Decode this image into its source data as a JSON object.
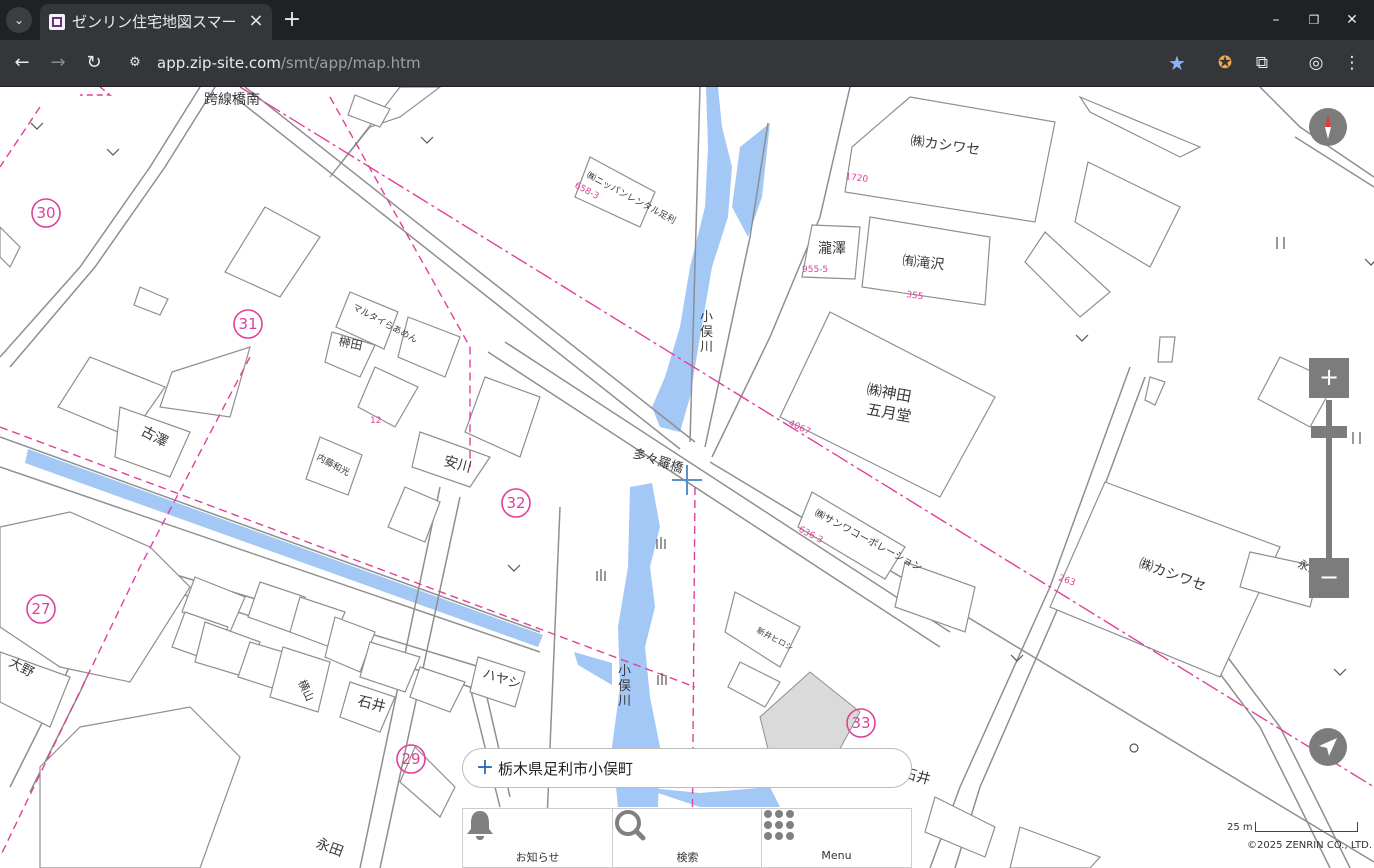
{
  "browser": {
    "tab_title": "ゼンリン住宅地図スマー",
    "tab_close": "×",
    "new_tab": "+",
    "url_host": "app.zip-site.com",
    "url_path": "/smt/app/map.htm",
    "tab_menu_glyph": "⌄",
    "back_glyph": "←",
    "forward_glyph": "→",
    "reload_glyph": "↻",
    "site_info_glyph": "⚙",
    "star_glyph": "★",
    "ext_glyph": "✪",
    "puzzle_glyph": "⧉",
    "profile_glyph": "◎",
    "menu_glyph": "⋮",
    "minimize_glyph": "–",
    "restore_glyph": "❐",
    "close_glyph": "✕",
    "accent_color": "#8ab4f8"
  },
  "map": {
    "area_labels": [
      "30",
      "31",
      "32",
      "27",
      "29",
      "33"
    ],
    "places": {
      "kyosenkyo_minami": "跨線橋南",
      "kashiwase_1": "㈱カシワセ",
      "kashiwase_2": "㈱カシワセ",
      "takizawa_kanji": "瀧澤",
      "takizawa": "㈲滝沢",
      "kanda_line1": "㈱神田",
      "kanda_line2": "五月堂",
      "sanwa": "㈱サンワコーポレーション",
      "nippan": "㈱ニッパンレンタル足利",
      "river1": "小俣川",
      "river2": "小俣川",
      "bridge": "多々羅橋",
      "sakaki": "榊田",
      "yasukawa": "安川",
      "furusawa": "古澤",
      "maruya": "マルタイらあめん",
      "naito": "内藤和光",
      "oono": "大野",
      "hayashi": "ハヤシ",
      "ishii_1": "石井",
      "ishii_2": "石井",
      "nagata": "永田",
      "yokoyama": "横山",
      "nagai": "永井",
      "arai": "新井ヒロシ"
    },
    "lot_numbers": {
      "n1720": "1720",
      "n955_5": "955-5",
      "n355": "355",
      "n4067": "4067",
      "n636_3": "636-3",
      "n263": "263",
      "n658_3": "658-3",
      "n12": "12"
    },
    "colors": {
      "boundary": "#e0409a",
      "water": "#a3c8f5",
      "roads": "#8f8f8f"
    }
  },
  "controls": {
    "zoom_in": "+",
    "zoom_out": "−",
    "zoom_level": 0.18,
    "scale_label": "25 m",
    "copyright": "©2025 ZENRIN CO., LTD."
  },
  "search": {
    "plus": "+",
    "address": "栃木県足利市小俣町"
  },
  "bottom_nav": {
    "items": [
      {
        "label": "お知らせ",
        "icon": "bell-icon"
      },
      {
        "label": "検索",
        "icon": "search-icon"
      },
      {
        "label": "Menu",
        "icon": "grid-menu-icon"
      }
    ]
  }
}
